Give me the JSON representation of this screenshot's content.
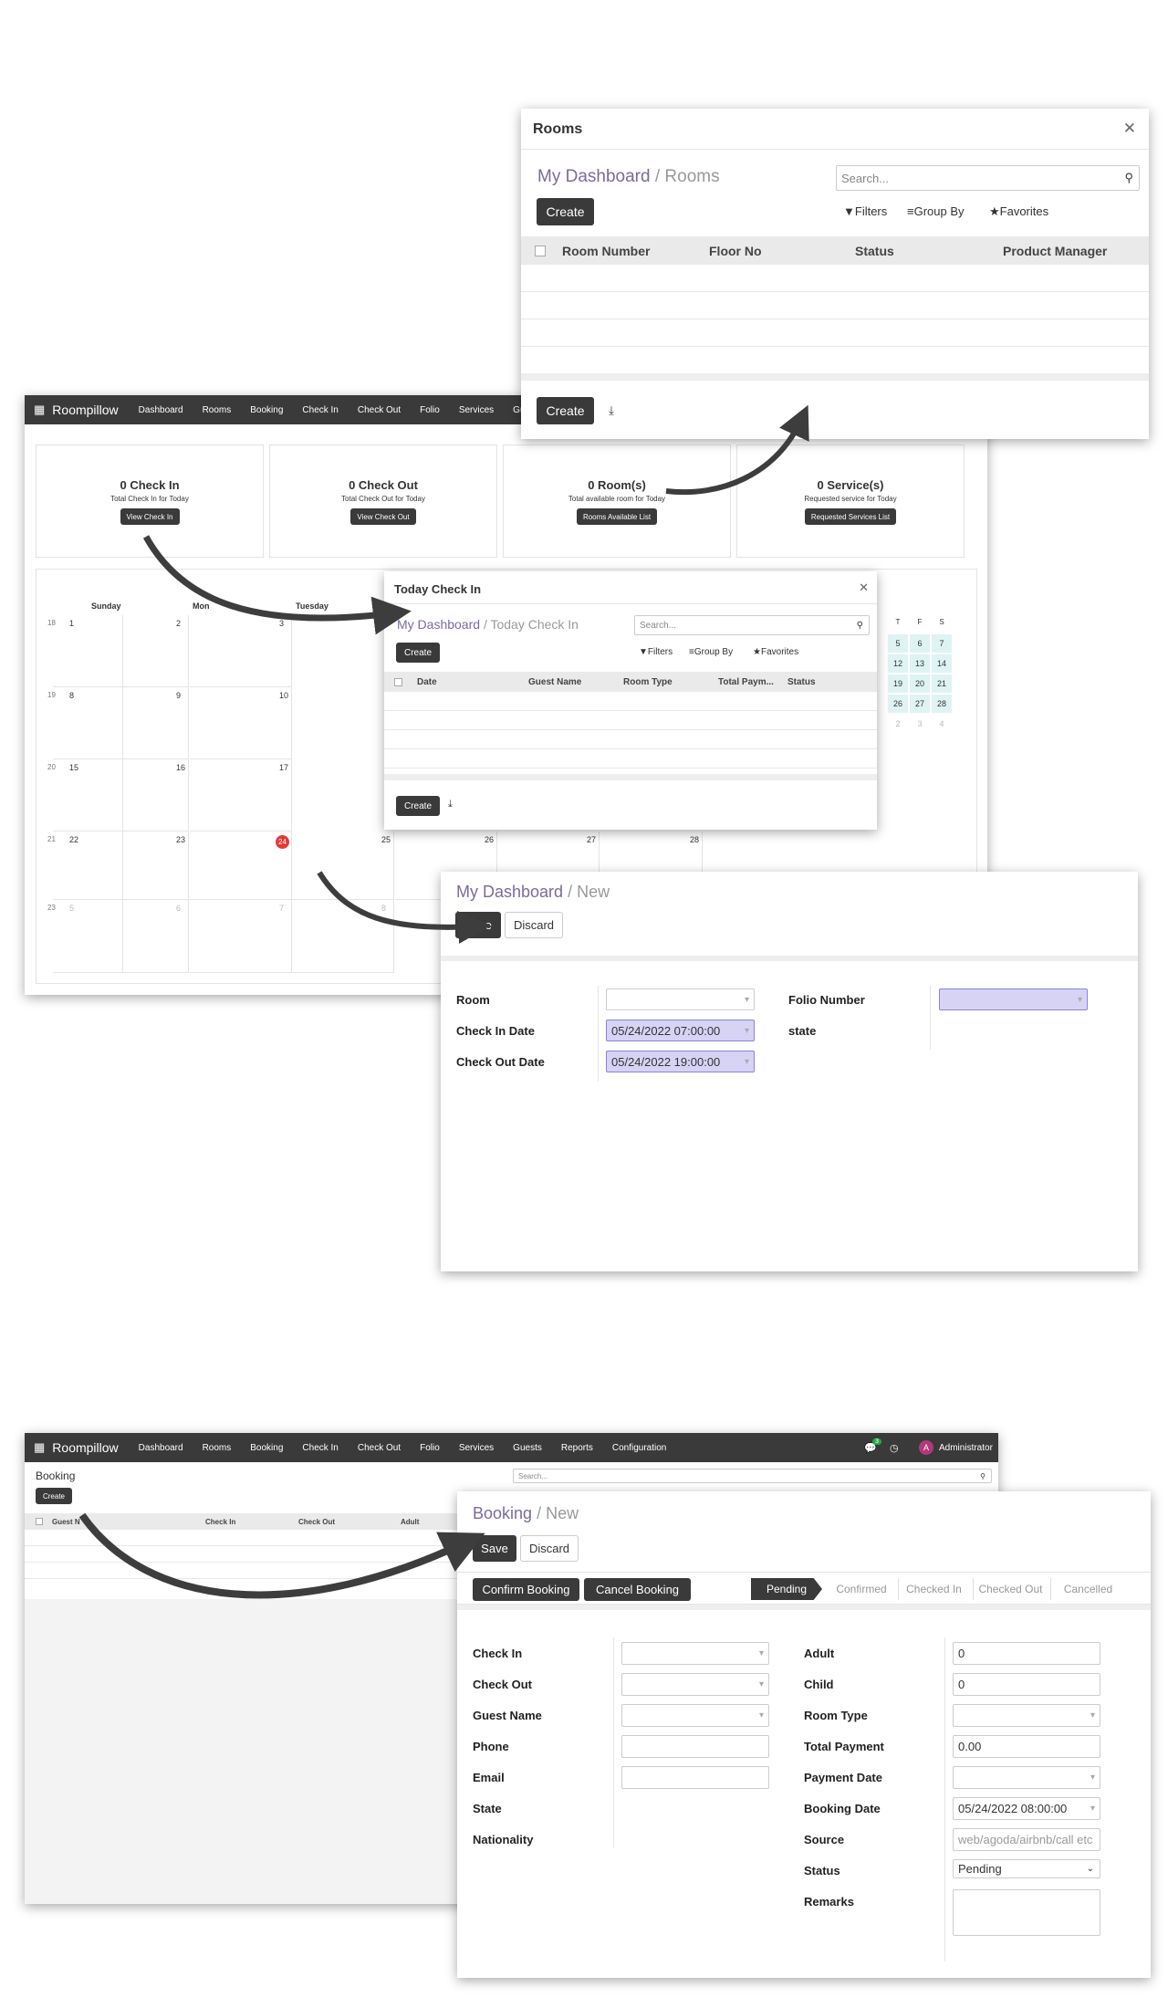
{
  "rooms_dialog": {
    "title": "Rooms",
    "breadcrumb_main": "My Dashboard",
    "breadcrumb_sep": "/",
    "breadcrumb_sub": "Rooms",
    "search_placeholder": "Search...",
    "create_label": "Create",
    "filters_label": "Filters",
    "groupby_label": "Group By",
    "favorites_label": "Favorites",
    "columns": [
      "Room Number",
      "Floor No",
      "Status",
      "Product Manager"
    ],
    "footer_create_label": "Create"
  },
  "navbar": {
    "brand": "Roompillow",
    "items": [
      "Dashboard",
      "Rooms",
      "Booking",
      "Check In",
      "Check Out",
      "Folio",
      "Services",
      "Guests"
    ]
  },
  "stats": [
    {
      "title": "0 Check In",
      "sub": "Total Check In for Today",
      "button": "View Check In"
    },
    {
      "title": "0 Check Out",
      "sub": "Total Check Out for Today",
      "button": "View Check Out"
    },
    {
      "title": "0 Room(s)",
      "sub": "Total available room for Today",
      "button": "Rooms Available List"
    },
    {
      "title": "0 Service(s)",
      "sub": "Requested service for Today",
      "button": "Requested Services List"
    }
  ],
  "calendar": {
    "day_headers": [
      "Sunday",
      "Mon",
      "Tuesday"
    ],
    "weeks": [
      {
        "wk": "18",
        "days": [
          "1",
          "2",
          "3"
        ]
      },
      {
        "wk": "19",
        "days": [
          "8",
          "9",
          "10"
        ]
      },
      {
        "wk": "20",
        "days": [
          "15",
          "16",
          "17"
        ]
      },
      {
        "wk": "21",
        "days": [
          "22",
          "23",
          "24",
          "25",
          "26",
          "27",
          "28"
        ]
      },
      {
        "wk": "23",
        "days": [
          "5",
          "6",
          "7",
          "8"
        ]
      }
    ],
    "mini_headers": [
      "T",
      "F",
      "S"
    ],
    "mini_rows": [
      [
        "5",
        "6",
        "7"
      ],
      [
        "12",
        "13",
        "14"
      ],
      [
        "19",
        "20",
        "21"
      ],
      [
        "26",
        "27",
        "28"
      ],
      [
        "2",
        "3",
        "4"
      ]
    ],
    "today": "24"
  },
  "checkin_dialog": {
    "title": "Today Check In",
    "breadcrumb_main": "My Dashboard",
    "breadcrumb_sep": "/",
    "breadcrumb_sub": "Today Check In",
    "search_placeholder": "Search...",
    "create_label": "Create",
    "filters_label": "Filters",
    "groupby_label": "Group By",
    "favorites_label": "Favorites",
    "columns": [
      "Date",
      "Guest Name",
      "Room Type",
      "Total Paym...",
      "Status"
    ],
    "footer_create_label": "Create"
  },
  "checkin_form": {
    "breadcrumb_main": "My Dashboard",
    "breadcrumb_sep": "/",
    "breadcrumb_sub": "New",
    "save_label": "Save",
    "discard_label": "Discard",
    "room_label": "Room",
    "checkin_date_label": "Check In Date",
    "checkin_date_value": "05/24/2022 07:00:00",
    "checkout_date_label": "Check Out Date",
    "checkout_date_value": "05/24/2022 19:00:00",
    "folio_label": "Folio Number",
    "state_label": "state"
  },
  "booking_nav": {
    "brand": "Roompillow",
    "items": [
      "Dashboard",
      "Rooms",
      "Booking",
      "Check In",
      "Check Out",
      "Folio",
      "Services",
      "Guests",
      "Reports",
      "Configuration"
    ],
    "chat_count": "3",
    "avatar_letter": "A",
    "user": "Administrator"
  },
  "booking_list": {
    "title": "Booking",
    "search_placeholder": "Search...",
    "create_label": "Create",
    "columns": [
      "Guest N",
      "Check In",
      "Check Out",
      "Adult"
    ]
  },
  "booking_form": {
    "breadcrumb_main": "Booking",
    "breadcrumb_sep": "/",
    "breadcrumb_sub": "New",
    "save_label": "Save",
    "discard_label": "Discard",
    "confirm_label": "Confirm Booking",
    "cancel_label": "Cancel Booking",
    "stages": [
      "Pending",
      "Confirmed",
      "Checked In",
      "Checked Out",
      "Cancelled"
    ],
    "left_labels": [
      "Check In",
      "Check Out",
      "Guest Name",
      "Phone",
      "Email",
      "State",
      "Nationality"
    ],
    "right_labels": [
      "Adult",
      "Child",
      "Room Type",
      "Total Payment",
      "Payment Date",
      "Booking Date",
      "Source",
      "Status",
      "Remarks"
    ],
    "adult_value": "0",
    "child_value": "0",
    "total_payment_value": "0.00",
    "booking_date_value": "05/24/2022 08:00:00",
    "source_placeholder": "web/agoda/airbnb/call etc",
    "status_value": "Pending"
  }
}
